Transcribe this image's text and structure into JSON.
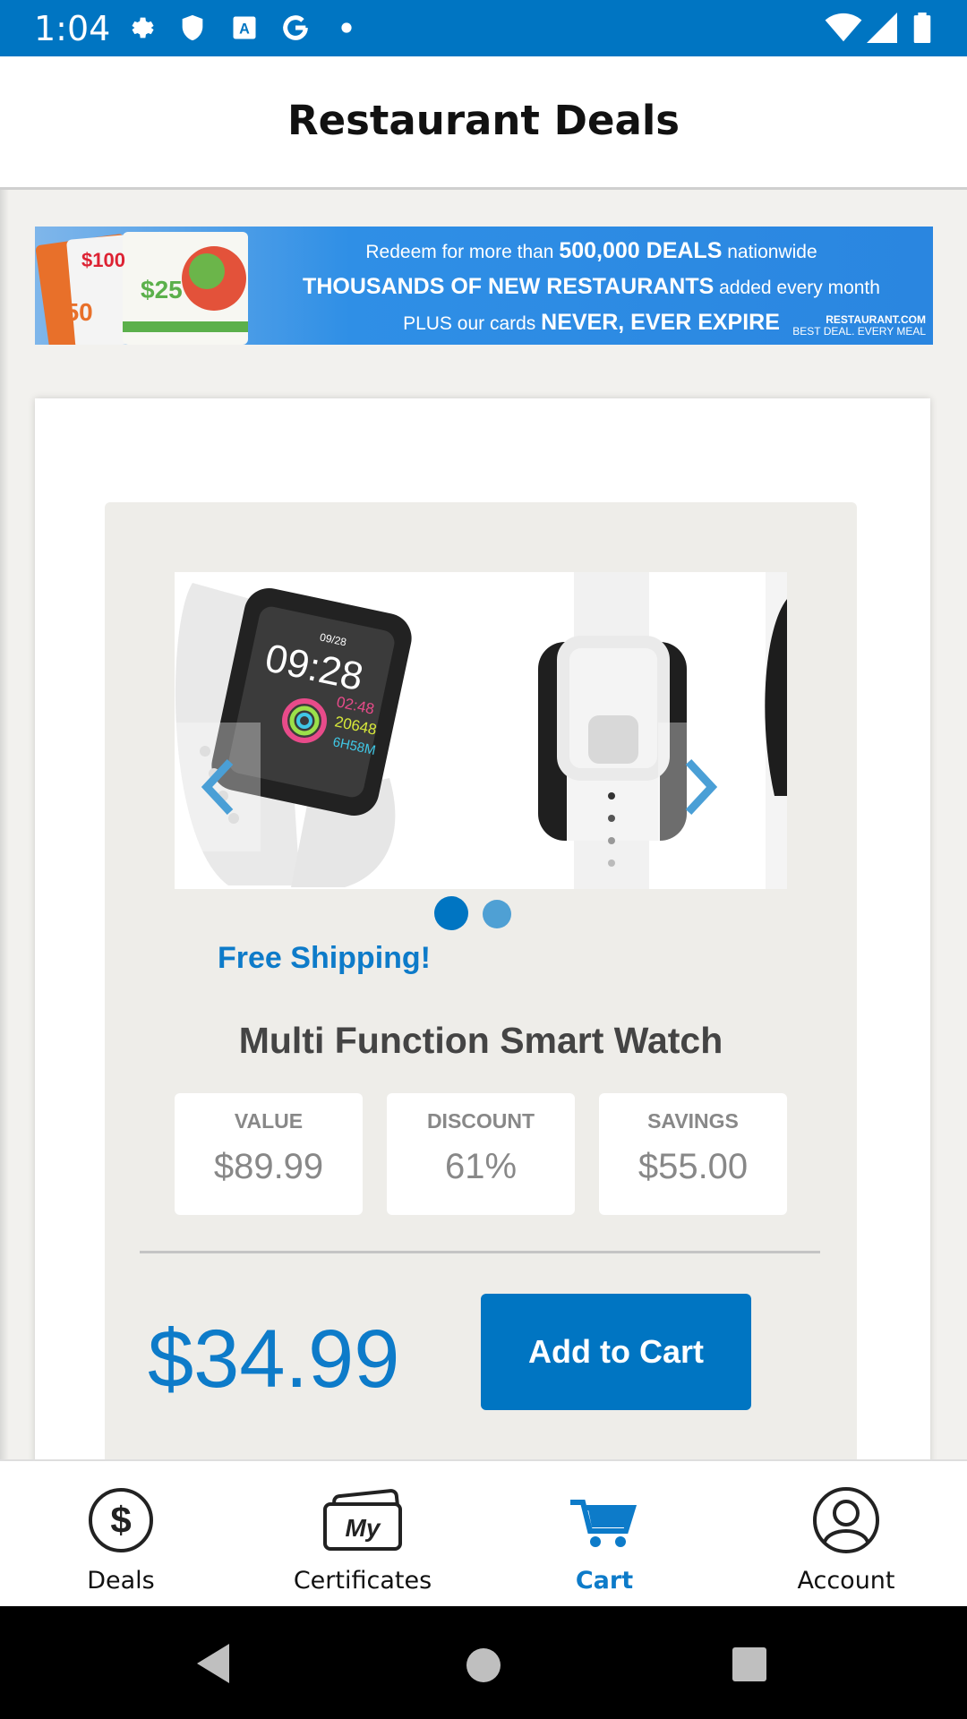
{
  "status_bar": {
    "time": "1:04"
  },
  "header": {
    "title": "Restaurant Deals"
  },
  "banner": {
    "line1_pre": "Redeem for more than",
    "line1_bold": "500,000 DEALS",
    "line1_post": "nationwide",
    "line2_bold": "THOUSANDS OF NEW RESTAURANTS",
    "line2_post": "added every month",
    "line3_pre": "PLUS our cards",
    "line3_bold": "NEVER, EVER EXPIRE",
    "logo_line1": "RESTAURANT.COM",
    "logo_line2": "BEST DEAL. EVERY MEAL",
    "card_values": [
      "$100",
      "$25",
      "$50"
    ]
  },
  "product": {
    "watch_time": "09:28",
    "watch_date": "09/28",
    "watch_stats": [
      "02:48",
      "20648",
      "6H58M"
    ],
    "shipping": "Free Shipping!",
    "title": "Multi Function Smart Watch",
    "stats": [
      {
        "label": "VALUE",
        "value": "$89.99"
      },
      {
        "label": "DISCOUNT",
        "value": "61%"
      },
      {
        "label": "SAVINGS",
        "value": "$55.00"
      }
    ],
    "price": "$34.99",
    "cart_label": "Add to Cart",
    "carousel_pages": 2,
    "carousel_active": 1
  },
  "bottom_nav": {
    "items": [
      {
        "label": "Deals",
        "icon": "dollar-circle-icon",
        "active": false
      },
      {
        "label": "Certificates",
        "icon": "my-certificates-icon",
        "active": false
      },
      {
        "label": "Cart",
        "icon": "cart-icon",
        "active": true
      },
      {
        "label": "Account",
        "icon": "person-icon",
        "active": false
      }
    ]
  },
  "colors": {
    "primary": "#0075c2",
    "accent_text": "#0d7bc9",
    "active_nav": "#0d7bc9"
  }
}
